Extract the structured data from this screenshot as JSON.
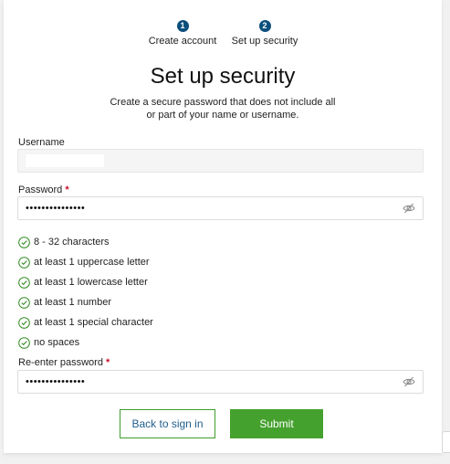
{
  "steps": [
    {
      "number": "1",
      "label": "Create account"
    },
    {
      "number": "2",
      "label": "Set up security"
    }
  ],
  "title": "Set up security",
  "subtitle_line1": "Create a secure password that does not include all",
  "subtitle_line2": "or part of your name or username.",
  "username": {
    "label": "Username",
    "value": ""
  },
  "password": {
    "label": "Password",
    "required_mark": "*",
    "masked_value": "•••••••••••••••",
    "eye_icon": "eye-off-icon"
  },
  "rules": [
    "8 - 32 characters",
    "at least 1 uppercase letter",
    "at least 1 lowercase letter",
    "at least 1 number",
    "at least 1 special character",
    "no spaces"
  ],
  "reenter": {
    "label": "Re-enter password",
    "required_mark": "*",
    "masked_value": "•••••••••••••••",
    "eye_icon": "eye-off-icon"
  },
  "buttons": {
    "back": "Back to sign in",
    "submit": "Submit"
  },
  "colors": {
    "step_badge": "#0b4f7c",
    "submit_bg": "#45a12e",
    "check": "#2f8a1f",
    "required": "#c8102e"
  }
}
